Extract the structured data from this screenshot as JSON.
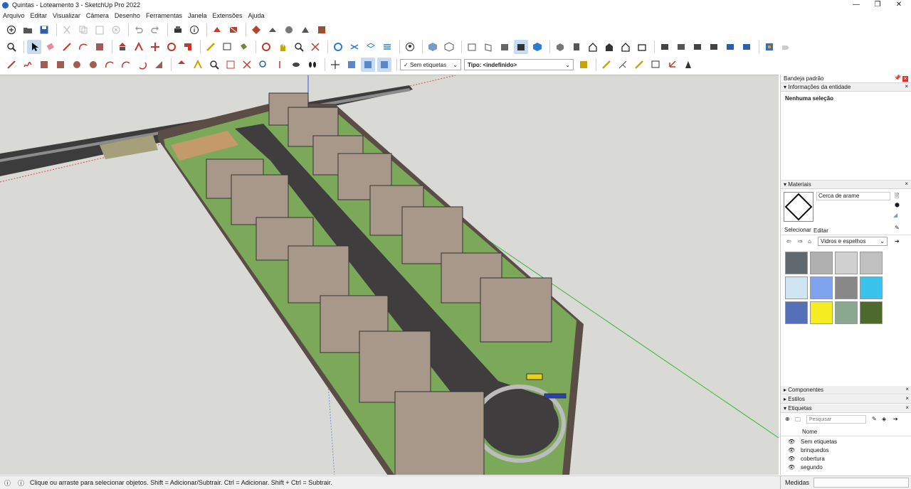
{
  "window": {
    "title": "Quintas - Loteamento 3 - SketchUp Pro 2022"
  },
  "menu": [
    "Arquivo",
    "Editar",
    "Visualizar",
    "Câmera",
    "Desenho",
    "Ferramentas",
    "Janela",
    "Extensões",
    "Ajuda"
  ],
  "toolbar": {
    "tag_filter": "Sem etiquetas",
    "type_filter": "Tipo: <indefinido>"
  },
  "tray": {
    "title": "Bandeja padrão",
    "entity_info": {
      "header": "Informações da entidade",
      "selection": "Nenhuma seleção"
    },
    "materials": {
      "header": "Materiais",
      "name": "Cerca de arame",
      "tab_select": "Selecionar",
      "tab_edit": "Editar",
      "library": "Vidros e espelhos"
    },
    "components_header": "Componentes",
    "styles_header": "Estilos",
    "tags": {
      "header": "Etiquetas",
      "search_placeholder": "Pesquisar",
      "column_name": "Nome",
      "items": [
        "Sem etiquetas",
        "brinquedos",
        "cobertura",
        "segundo"
      ]
    }
  },
  "status": {
    "hint": "Clique ou arraste para selecionar objetos. Shift = Adicionar/Subtrair. Ctrl = Adicionar. Shift + Ctrl = Subtrair.",
    "measurements_label": "Medidas"
  },
  "colors": {
    "accent": "#2563c9",
    "active_tool": "#c7dcf2",
    "ground": "#d9d9d6",
    "road": "#3f3d3d",
    "lawn": "#6f9a4a",
    "house": "#a8988a"
  }
}
